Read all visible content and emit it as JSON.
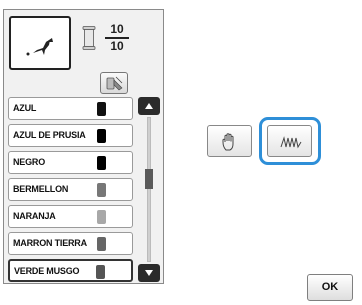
{
  "counter": {
    "current": "10",
    "total": "10"
  },
  "thread_list": {
    "items": [
      {
        "label": "AZUL",
        "color": "#111111"
      },
      {
        "label": "AZUL DE PRUSIA",
        "color": "#000000"
      },
      {
        "label": "NEGRO",
        "color": "#000000"
      },
      {
        "label": "BERMELLON",
        "color": "#777777"
      },
      {
        "label": "NARANJA",
        "color": "#a8a8a8"
      },
      {
        "label": "MARRON TIERRA",
        "color": "#666666"
      },
      {
        "label": "VERDE MUSGO",
        "color": "#555555"
      }
    ],
    "selected_index": 6
  },
  "scrollbar": {
    "position": 0.5
  },
  "buttons": {
    "ok_label": "OK",
    "selected_tool": "stitch-button"
  },
  "colors": {
    "highlight": "#2e8fd8",
    "scroll_button": "#2b2b2b",
    "panel_bg": "#f1f1f1"
  }
}
